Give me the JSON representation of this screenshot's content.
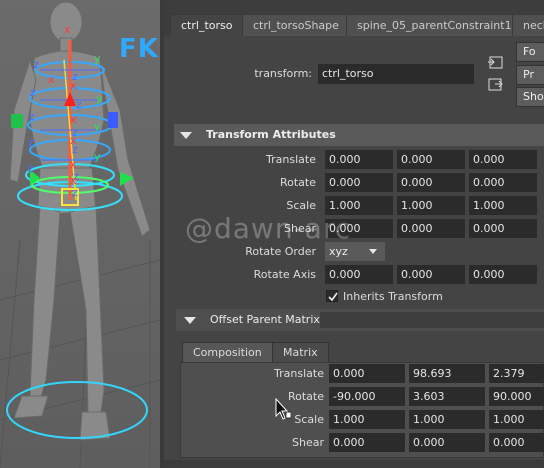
{
  "viewport": {
    "fk_label": "FK",
    "axis_labels": [
      "x",
      "y",
      "z",
      "z",
      "x",
      "z",
      "x",
      "z",
      "z",
      "x",
      "y",
      "z",
      "z",
      "z",
      "x",
      "y",
      "z",
      "x",
      "z",
      "z",
      "x",
      "y"
    ]
  },
  "tabs": [
    {
      "label": "ctrl_torso",
      "active": true
    },
    {
      "label": "ctrl_torsoShape",
      "active": false
    },
    {
      "label": "spine_05_parentConstraint1",
      "active": false
    },
    {
      "label": "neck",
      "active": false
    }
  ],
  "transform": {
    "label": "transform:",
    "value": "ctrl_torso"
  },
  "side_buttons": [
    "Fo",
    "Pr",
    "Show"
  ],
  "transform_attributes": {
    "title": "Transform Attributes",
    "rows": [
      {
        "label": "Translate",
        "values": [
          "0.000",
          "0.000",
          "0.000"
        ]
      },
      {
        "label": "Rotate",
        "values": [
          "0.000",
          "0.000",
          "0.000"
        ]
      },
      {
        "label": "Scale",
        "values": [
          "1.000",
          "1.000",
          "1.000"
        ]
      },
      {
        "label": "Shear",
        "values": [
          "0.000",
          "0.000",
          "0.000"
        ]
      }
    ],
    "rotate_order": {
      "label": "Rotate Order",
      "value": "xyz"
    },
    "rotate_axis": {
      "label": "Rotate Axis",
      "values": [
        "0.000",
        "0.000",
        "0.000"
      ]
    },
    "inherits_transform": {
      "label": "Inherits Transform",
      "checked": true
    }
  },
  "offset_parent_matrix": {
    "title": "Offset Parent Matrix",
    "subtabs": [
      "Composition",
      "Matrix"
    ],
    "rows": [
      {
        "label": "Translate",
        "values": [
          "0.000",
          "98.693",
          "2.379"
        ]
      },
      {
        "label": "Rotate",
        "values": [
          "-90.000",
          "3.603",
          "90.000"
        ]
      },
      {
        "label": "Scale",
        "values": [
          "1.000",
          "1.000",
          "1.000"
        ]
      },
      {
        "label": "Shear",
        "values": [
          "0.000",
          "0.000",
          "0.000"
        ]
      }
    ]
  },
  "watermark": "@dawn-arc"
}
